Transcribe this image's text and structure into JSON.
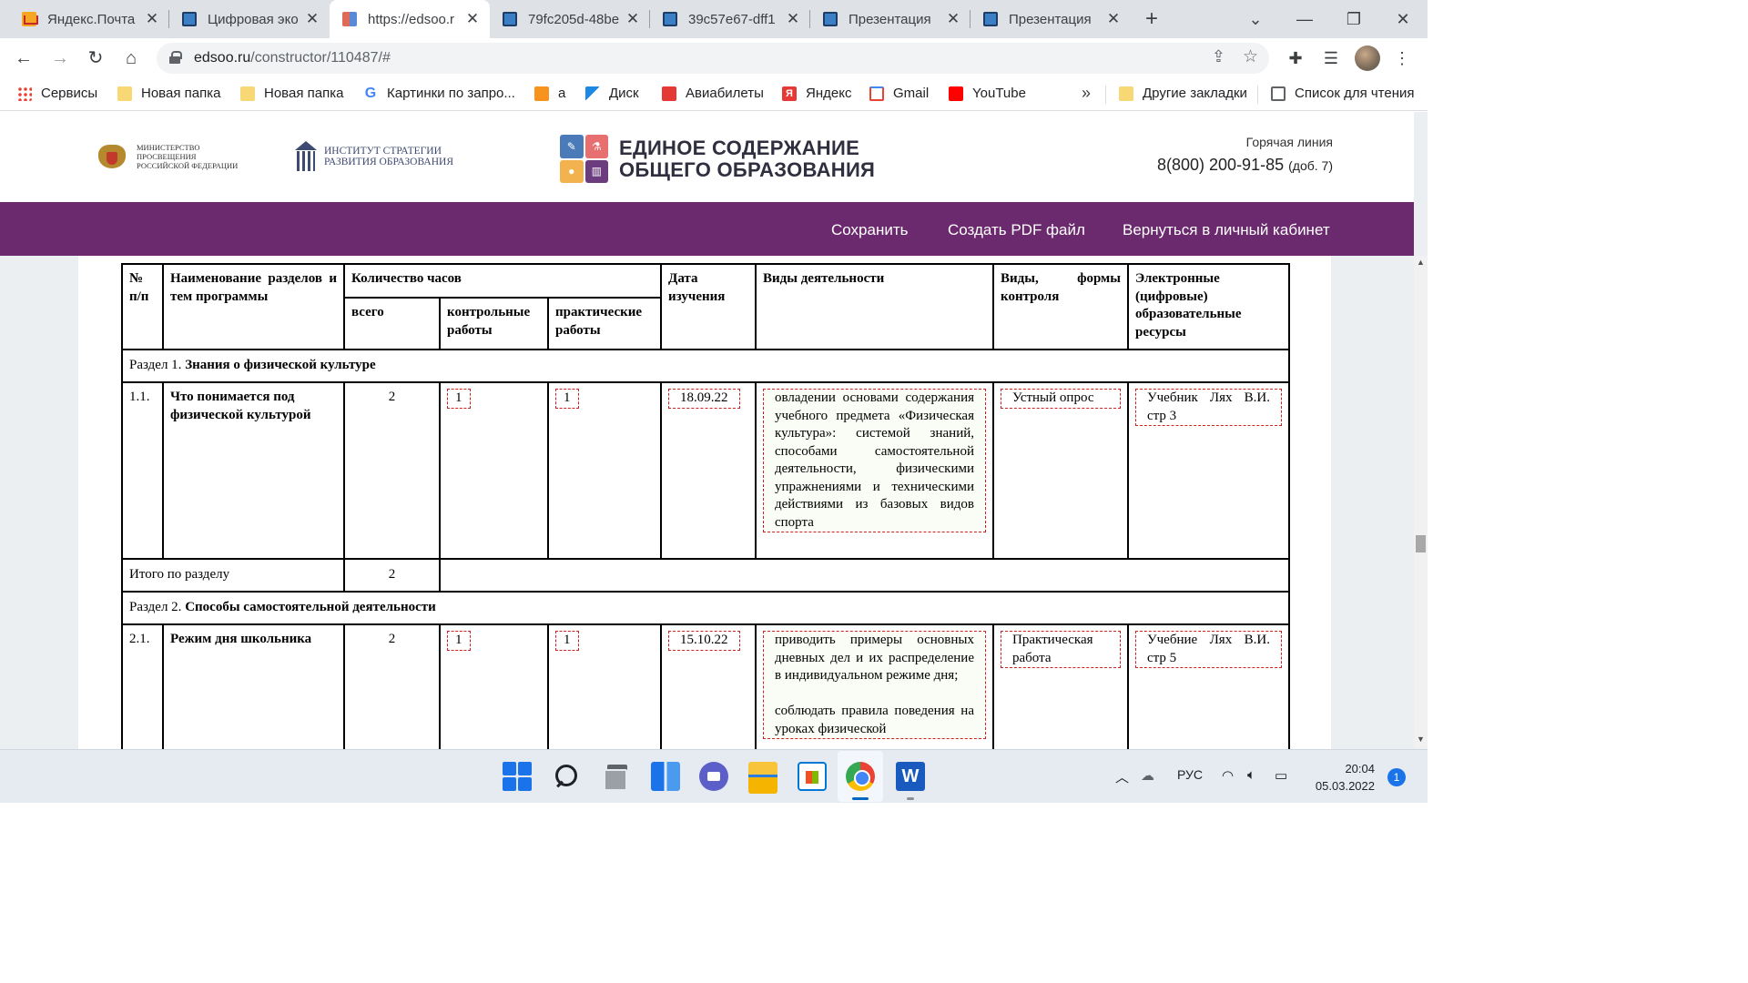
{
  "browser": {
    "tabs": [
      {
        "title": "Яндекс.Почта",
        "icon": "yandex-mail-icon"
      },
      {
        "title": "Цифровая эко",
        "icon": "book-icon"
      },
      {
        "title": "https://edsoo.r",
        "icon": "edsoo-icon"
      },
      {
        "title": "79fc205d-48be",
        "icon": "book-icon"
      },
      {
        "title": "39c57e67-dff1",
        "icon": "book-icon"
      },
      {
        "title": "Презентация",
        "icon": "book-icon"
      },
      {
        "title": "Презентация",
        "icon": "book-icon"
      }
    ],
    "active_tab_index": 2,
    "url_host": "edsoo.ru",
    "url_path": "/constructor/110487/#",
    "bookmarks": [
      {
        "label": "Сервисы",
        "icon": "apps-icon"
      },
      {
        "label": "Новая папка",
        "icon": "folder-icon"
      },
      {
        "label": "Новая папка",
        "icon": "folder-icon"
      },
      {
        "label": "Картинки по запро...",
        "icon": "google-icon"
      },
      {
        "label": "а",
        "icon": "odnoklassniki-icon"
      },
      {
        "label": "Диск",
        "icon": "disk-icon"
      },
      {
        "label": "Авиабилеты",
        "icon": "aviabilety-icon"
      },
      {
        "label": "Яндекс",
        "icon": "yandex-icon"
      },
      {
        "label": "Gmail",
        "icon": "gmail-icon"
      },
      {
        "label": "YouTube",
        "icon": "youtube-icon"
      }
    ],
    "other_bookmarks": "Другие закладки",
    "reading_list": "Список для чтения"
  },
  "site": {
    "ministry_name": "МИНИСТЕРСТВО ПРОСВЕЩЕНИЯ РОССИЙСКОЙ ФЕДЕРАЦИИ",
    "institute_line1": "ИНСТИТУТ СТРАТЕГИИ",
    "institute_line2": "РАЗВИТИЯ ОБРАЗОВАНИЯ",
    "brand_line1": "ЕДИНОЕ СОДЕРЖАНИЕ",
    "brand_line2": "ОБЩЕГО ОБРАЗОВАНИЯ",
    "hotline_label": "Горячая линия",
    "hotline_phone": "8(800) 200-91-85",
    "hotline_ext": "(доб. 7)",
    "actions": {
      "save": "Сохранить",
      "pdf": "Создать PDF файл",
      "back": "Вернуться в личный кабинет"
    },
    "brand_color": "#6c2a6e"
  },
  "table": {
    "headers": {
      "num": "№ п/п",
      "name": "Наименование разделов и тем программы",
      "hours": "Количество часов",
      "total": "всего",
      "control": "контрольные работы",
      "practical": "практические работы",
      "date": "Дата изучения",
      "activities": "Виды деятельности",
      "forms_a": "Виды,",
      "forms_b": "формы",
      "forms_c": "контроля",
      "resources": "Электронные (цифровые) образовательные ресурсы"
    },
    "section1": {
      "prefix": "Раздел 1.",
      "title": "Знания о физической культуре"
    },
    "row1": {
      "num": "1.1.",
      "name": "Что понимается под физической культурой",
      "total": "2",
      "control": "1",
      "practical": "1",
      "date": "18.09.22",
      "activities": "овладении основами содержания учебного предмета «Физическая культура»: системой знаний, способами самостоятельной деятельности, физическими упражнениями и техническими действиями из базовых видов спорта",
      "forms": "Устный опрос",
      "resources": "Учебник Лях В.И. стр 3"
    },
    "summary1": {
      "label": "Итого по разделу",
      "total": "2"
    },
    "section2": {
      "prefix": "Раздел 2.",
      "title": "Способы самостоятельной деятельности"
    },
    "row2": {
      "num": "2.1.",
      "name": "Режим дня школьника",
      "total": "2",
      "control": "1",
      "practical": "1",
      "date": "15.10.22",
      "activities_p1": "приводить примеры основных дневных дел и их распределение в индивидуальном режиме дня;",
      "activities_p2": "соблюдать правила поведения на уроках физической",
      "forms": "Практическая работа",
      "resources": "Учебние Лях В.И. стр 5"
    }
  },
  "taskbar": {
    "apps": [
      "windows-start-icon",
      "search-icon",
      "task-view-icon",
      "widgets-icon",
      "chat-icon",
      "file-explorer-icon",
      "store-icon",
      "chrome-icon",
      "word-icon"
    ],
    "language": "РУС",
    "time": "20:04",
    "date": "05.03.2022",
    "notifications": "1"
  }
}
